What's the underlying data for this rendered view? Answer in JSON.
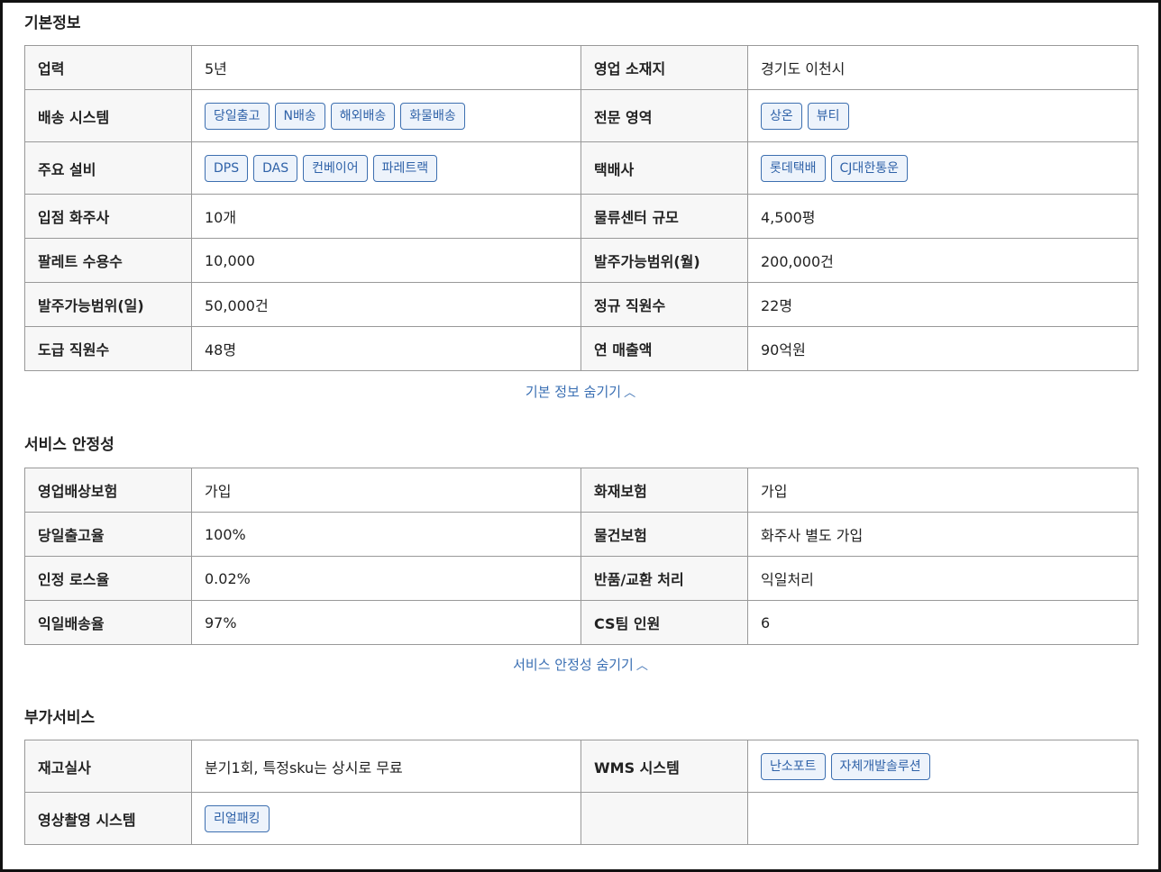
{
  "basic": {
    "title": "기본정보",
    "rows": [
      {
        "k1": "업력",
        "v1": "5년",
        "k2": "영업 소재지",
        "v2": "경기도 이천시"
      },
      {
        "k1": "배송 시스템",
        "chips1": [
          "당일출고",
          "N배송",
          "해외배송",
          "화물배송"
        ],
        "k2": "전문 영역",
        "chips2": [
          "상온",
          "뷰티"
        ]
      },
      {
        "k1": "주요 설비",
        "chips1": [
          "DPS",
          "DAS",
          "컨베이어",
          "파레트랙"
        ],
        "k2": "택배사",
        "chips2": [
          "롯데택배",
          "CJ대한통운"
        ]
      },
      {
        "k1": "입점 화주사",
        "v1": "10개",
        "k2": "물류센터 규모",
        "v2": "4,500평"
      },
      {
        "k1": "팔레트 수용수",
        "v1": "10,000",
        "k2": "발주가능범위(월)",
        "v2": "200,000건"
      },
      {
        "k1": "발주가능범위(일)",
        "v1": "50,000건",
        "k2": "정규 직원수",
        "v2": "22명"
      },
      {
        "k1": "도급 직원수",
        "v1": "48명",
        "k2": "연 매출액",
        "v2": "90억원"
      }
    ],
    "toggle_label": "기본 정보 숨기기",
    "toggle_icon": "^"
  },
  "stability": {
    "title": "서비스 안정성",
    "rows": [
      {
        "k1": "영업배상보험",
        "v1": "가입",
        "k2": "화재보험",
        "v2": "가입"
      },
      {
        "k1": "당일출고율",
        "v1": "100%",
        "k2": "물건보험",
        "v2": "화주사 별도 가입"
      },
      {
        "k1": "인정 로스율",
        "v1": "0.02%",
        "k2": "반품/교환 처리",
        "v2": "익일처리"
      },
      {
        "k1": "익일배송율",
        "v1": "97%",
        "k2": "CS팀 인원",
        "v2": "6"
      }
    ],
    "toggle_label": "서비스 안정성 숨기기",
    "toggle_icon": "^"
  },
  "extra": {
    "title": "부가서비스",
    "rows": [
      {
        "k1": "재고실사",
        "v1": "분기1회, 특정sku는 상시로 무료",
        "k2": "WMS 시스템",
        "chips2": [
          "난소포트",
          "자체개발솔루션"
        ]
      },
      {
        "k1": "영상촬영 시스템",
        "chips1": [
          "리얼패킹"
        ],
        "k2": "",
        "v2": ""
      }
    ]
  },
  "colors": {
    "chip_border": "#3d6fb0",
    "chip_bg": "#edf3fb",
    "chip_text": "#2f62a8",
    "key_bg": "#f7f7f7",
    "link": "#3a6fb3"
  }
}
